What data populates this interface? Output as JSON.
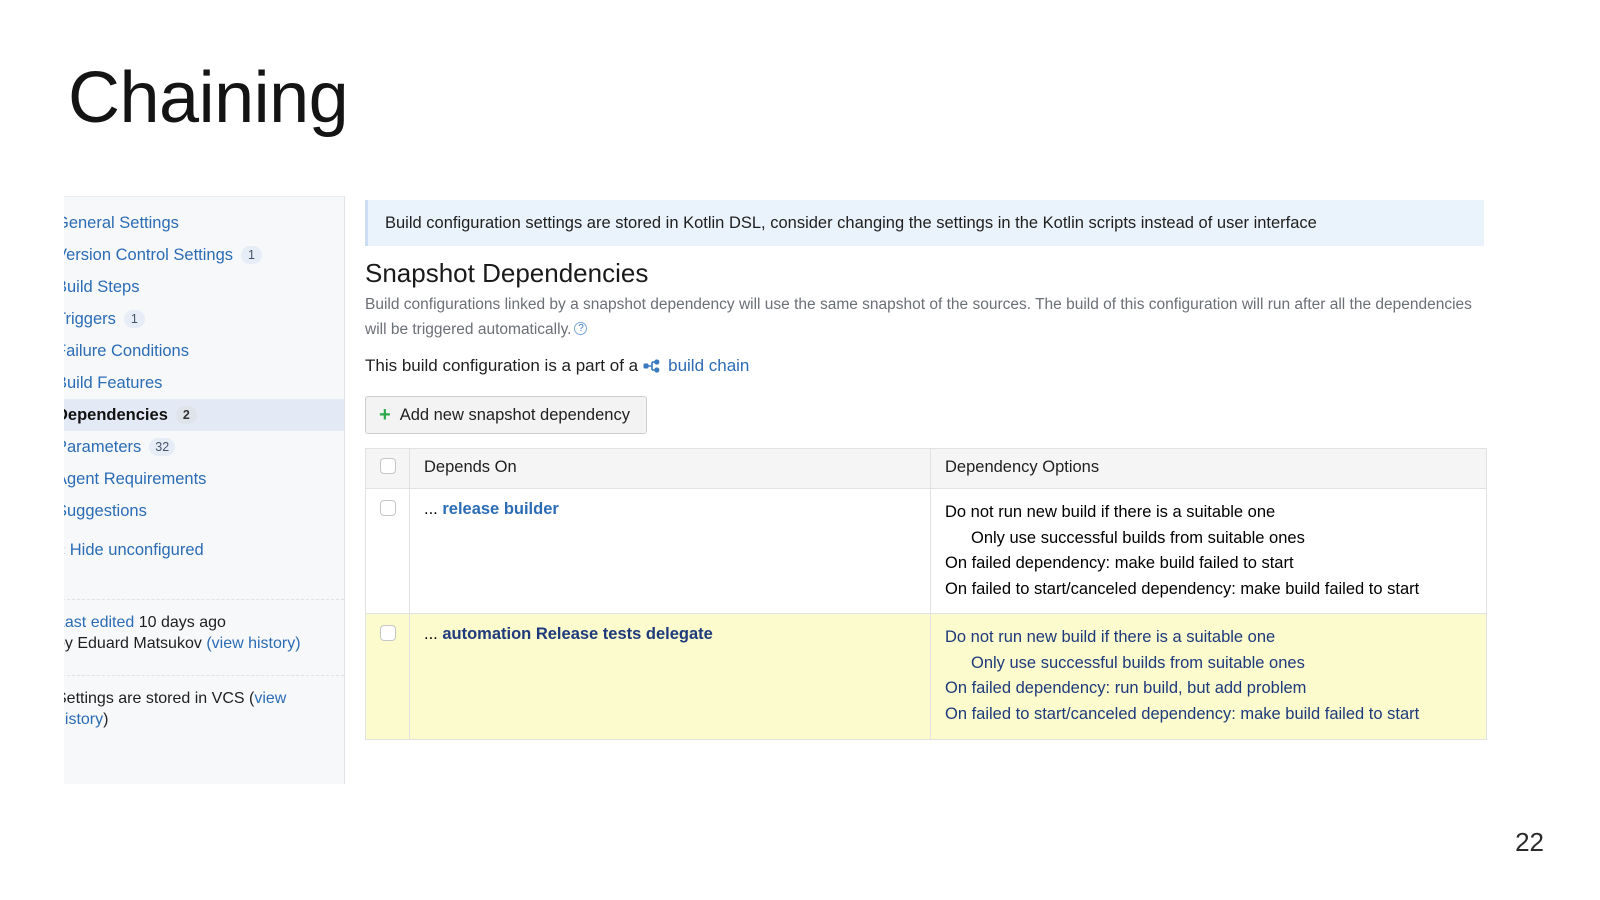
{
  "slide": {
    "title": "Chaining",
    "page_number": "22"
  },
  "sidebar": {
    "items": [
      {
        "label": "General Settings",
        "badge": "",
        "active": false
      },
      {
        "label": "Version Control Settings",
        "badge": "1",
        "active": false
      },
      {
        "label": "Build Steps",
        "badge": "",
        "active": false
      },
      {
        "label": "Triggers",
        "badge": "1",
        "active": false
      },
      {
        "label": "Failure Conditions",
        "badge": "",
        "active": false
      },
      {
        "label": "Build Features",
        "badge": "",
        "active": false
      },
      {
        "label": "Dependencies",
        "badge": "2",
        "active": true
      },
      {
        "label": "Parameters",
        "badge": "32",
        "active": false
      },
      {
        "label": "Agent Requirements",
        "badge": "",
        "active": false
      },
      {
        "label": "Suggestions",
        "badge": "",
        "active": false
      }
    ],
    "hide_unconfigured": "« Hide unconfigured",
    "last_edited_label": "Last edited",
    "last_edited_value": "10 days ago",
    "by_author": "by Eduard Matsukov",
    "view_history": "(view history)",
    "vcs_notice": "Settings are stored in VCS (",
    "vcs_link": "view history",
    "vcs_notice_end": ")"
  },
  "main": {
    "dsl_banner": "Build configuration settings are stored in Kotlin DSL, consider changing the settings in the Kotlin scripts instead of user interface",
    "section_title": "Snapshot Dependencies",
    "section_desc": "Build configurations linked by a snapshot dependency will use the same snapshot of the sources. The build of this configuration will run after all the dependencies will be triggered automatically.",
    "help_glyph": "?",
    "chain_text": "This build configuration is a part of a",
    "chain_link": "build chain",
    "chain_icon": "build-chain-icon",
    "add_button": "Add new snapshot dependency",
    "plus_glyph": "+"
  },
  "table": {
    "columns": [
      "Depends On",
      "Dependency Options"
    ],
    "rows": [
      {
        "depends_on_prefix": "... ",
        "depends_on": "release builder",
        "options": [
          "Do not run new build if there is a suitable one",
          "Only use successful builds from suitable ones",
          "On failed dependency: make build failed to start",
          "On failed to start/canceled dependency: make build failed to start"
        ],
        "highlighted": false
      },
      {
        "depends_on_prefix": "... ",
        "depends_on": "automation Release tests delegate",
        "options": [
          "Do not run new build if there is a suitable one",
          "Only use successful builds from suitable ones",
          "On failed dependency: run build, but add problem",
          "On failed to start/canceled dependency: make build failed to start"
        ],
        "highlighted": true
      }
    ]
  },
  "colors": {
    "link": "#2b6cb5",
    "banner_bg": "#eaf2fb",
    "highlight_row": "#fbfbcd",
    "highlight_text": "#1e3a7a",
    "plus_green": "#2ba84a",
    "active_nav_bg": "#e4eaf5"
  }
}
